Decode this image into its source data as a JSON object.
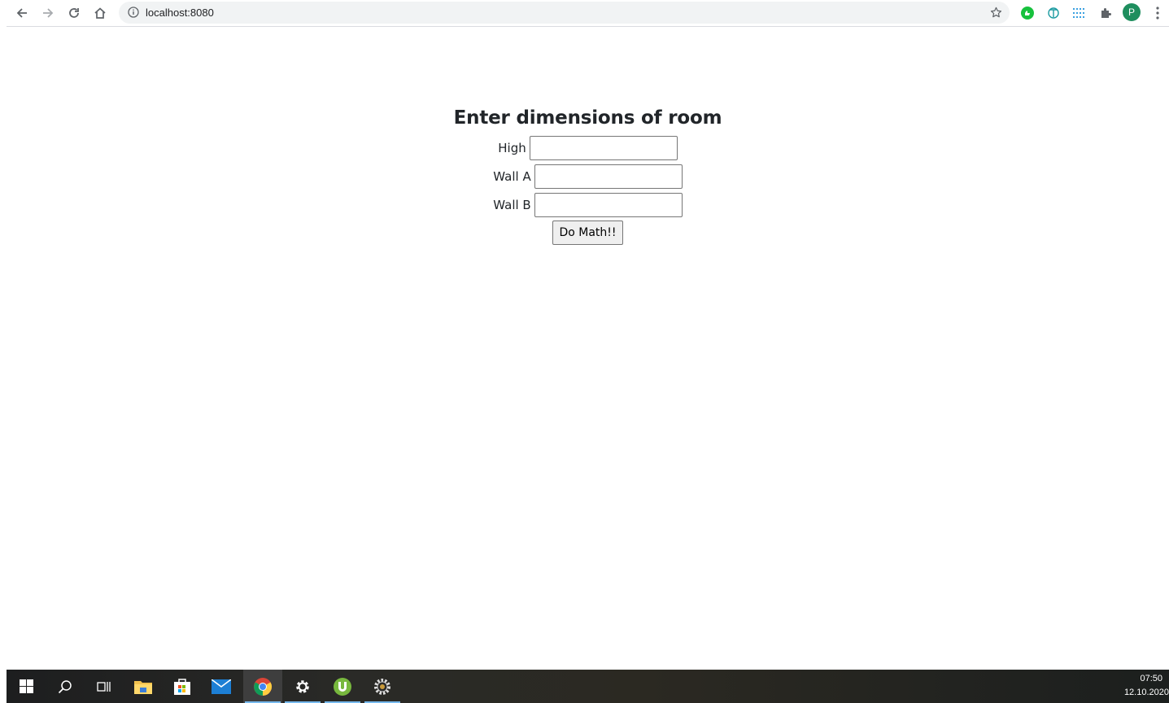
{
  "browser": {
    "url": "localhost:8080",
    "profile_initial": "P",
    "icons": [
      "back-arrow-icon",
      "forward-arrow-icon",
      "reload-icon",
      "home-icon",
      "info-icon",
      "star-icon",
      "extension-green-icon",
      "extension-translate-icon",
      "extension-grid-icon",
      "puzzle-icon",
      "menu-dots-icon"
    ]
  },
  "form": {
    "title": "Enter dimensions of room",
    "fields": [
      {
        "label": "High",
        "value": ""
      },
      {
        "label": "Wall A",
        "value": ""
      },
      {
        "label": "Wall B",
        "value": ""
      }
    ],
    "submit_label": "Do Math!!"
  },
  "taskbar": {
    "apps": [
      "windows-start-icon",
      "search-icon",
      "task-view-icon",
      "file-explorer-icon",
      "store-icon",
      "mail-icon",
      "chrome-icon",
      "settings-icon",
      "utorrent-icon",
      "gear-app-icon"
    ],
    "time": "07:50",
    "date": "12.10.2020"
  },
  "colors": {
    "accent_underline": "#76b9ed",
    "avatar": "#1e8e5e"
  }
}
